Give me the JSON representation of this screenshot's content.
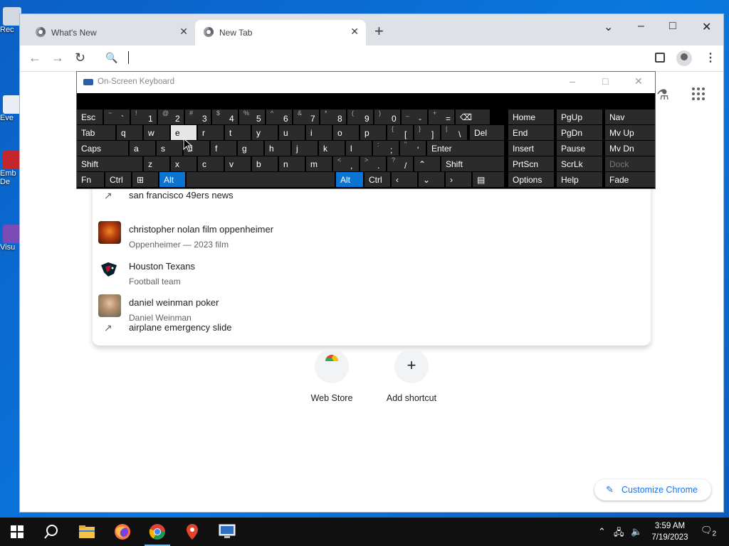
{
  "desktop": {
    "icons": [
      "Rec",
      "Eve",
      "Emb De",
      "Visu"
    ]
  },
  "browser": {
    "tabs": [
      {
        "label": "What's New",
        "active": false
      },
      {
        "label": "New Tab",
        "active": true
      }
    ],
    "new_tab_symbol": "+",
    "window_controls": {
      "tab_search": "⌄",
      "minimize": "–",
      "maximize": "□",
      "close": "✕"
    },
    "toolbar": {
      "back": "←",
      "forward": "→",
      "reload": "↻",
      "omnibox_value": ""
    },
    "icons": [
      "search-icon",
      "side-panel-icon",
      "profile-icon",
      "menu-icon",
      "labs-icon",
      "apps-icon"
    ]
  },
  "suggestions": [
    {
      "title": "san francisco 49ers news",
      "subtitle": "",
      "icon": "trend-icon"
    },
    {
      "title": "christopher nolan film oppenheimer",
      "subtitle": "Oppenheimer — 2023 film",
      "icon": "thumbnail"
    },
    {
      "title": "Houston Texans",
      "subtitle": "Football team",
      "icon": "team-logo"
    },
    {
      "title": "daniel weinman poker",
      "subtitle": "Daniel Weinman",
      "icon": "thumbnail"
    },
    {
      "title": "airplane emergency slide",
      "subtitle": "",
      "icon": "trend-icon"
    }
  ],
  "shortcuts": [
    {
      "label": "Web Store"
    },
    {
      "label": "Add shortcut"
    }
  ],
  "customize_label": "Customize Chrome",
  "osk": {
    "title": "On-Screen Keyboard",
    "row1": [
      {
        "shift": "~",
        "main": "`"
      },
      {
        "shift": "!",
        "main": "1"
      },
      {
        "shift": "@",
        "main": "2"
      },
      {
        "shift": "#",
        "main": "3"
      },
      {
        "shift": "$",
        "main": "4"
      },
      {
        "shift": "%",
        "main": "5"
      },
      {
        "shift": "^",
        "main": "6"
      },
      {
        "shift": "&",
        "main": "7"
      },
      {
        "shift": "*",
        "main": "8"
      },
      {
        "shift": "(",
        "main": "9"
      },
      {
        "shift": ")",
        "main": "0"
      },
      {
        "shift": "_",
        "main": "-"
      },
      {
        "shift": "+",
        "main": "="
      }
    ],
    "esc": "Esc",
    "tab": "Tab",
    "row2": [
      "q",
      "w",
      "e",
      "r",
      "t",
      "y",
      "u",
      "i",
      "o",
      "p"
    ],
    "row2_brackets": [
      {
        "shift": "{",
        "main": "["
      },
      {
        "shift": "}",
        "main": "]"
      },
      {
        "shift": "|",
        "main": "\\"
      }
    ],
    "del": "Del",
    "caps": "Caps",
    "row3": [
      "a",
      "s",
      "d",
      "f",
      "g",
      "h",
      "j",
      "k",
      "l"
    ],
    "row3_punct": [
      {
        "shift": ":",
        "main": ";"
      },
      {
        "shift": "\"",
        "main": "'"
      }
    ],
    "enter": "Enter",
    "shift": "Shift",
    "row4": [
      "z",
      "x",
      "c",
      "v",
      "b",
      "n",
      "m"
    ],
    "row4_punct": [
      {
        "shift": "<",
        "main": ","
      },
      {
        "shift": ">",
        "main": "."
      },
      {
        "shift": "?",
        "main": "/"
      }
    ],
    "fn": "Fn",
    "ctrl": "Ctrl",
    "alt": "Alt",
    "nav_keys": [
      [
        "Home",
        "PgUp",
        "Nav"
      ],
      [
        "End",
        "PgDn",
        "Mv Up"
      ],
      [
        "Insert",
        "Pause",
        "Mv Dn"
      ],
      [
        "PrtScn",
        "ScrLk",
        "Dock"
      ],
      [
        "Options",
        "Help",
        "Fade"
      ]
    ]
  },
  "taskbar": {
    "apps": [
      "start-icon",
      "search-icon",
      "file-explorer-icon",
      "firefox-icon",
      "chrome-icon",
      "maps-pin-icon",
      "remote-desktop-icon"
    ],
    "time": "3:59 AM",
    "date": "7/19/2023",
    "notification_count": "2"
  }
}
